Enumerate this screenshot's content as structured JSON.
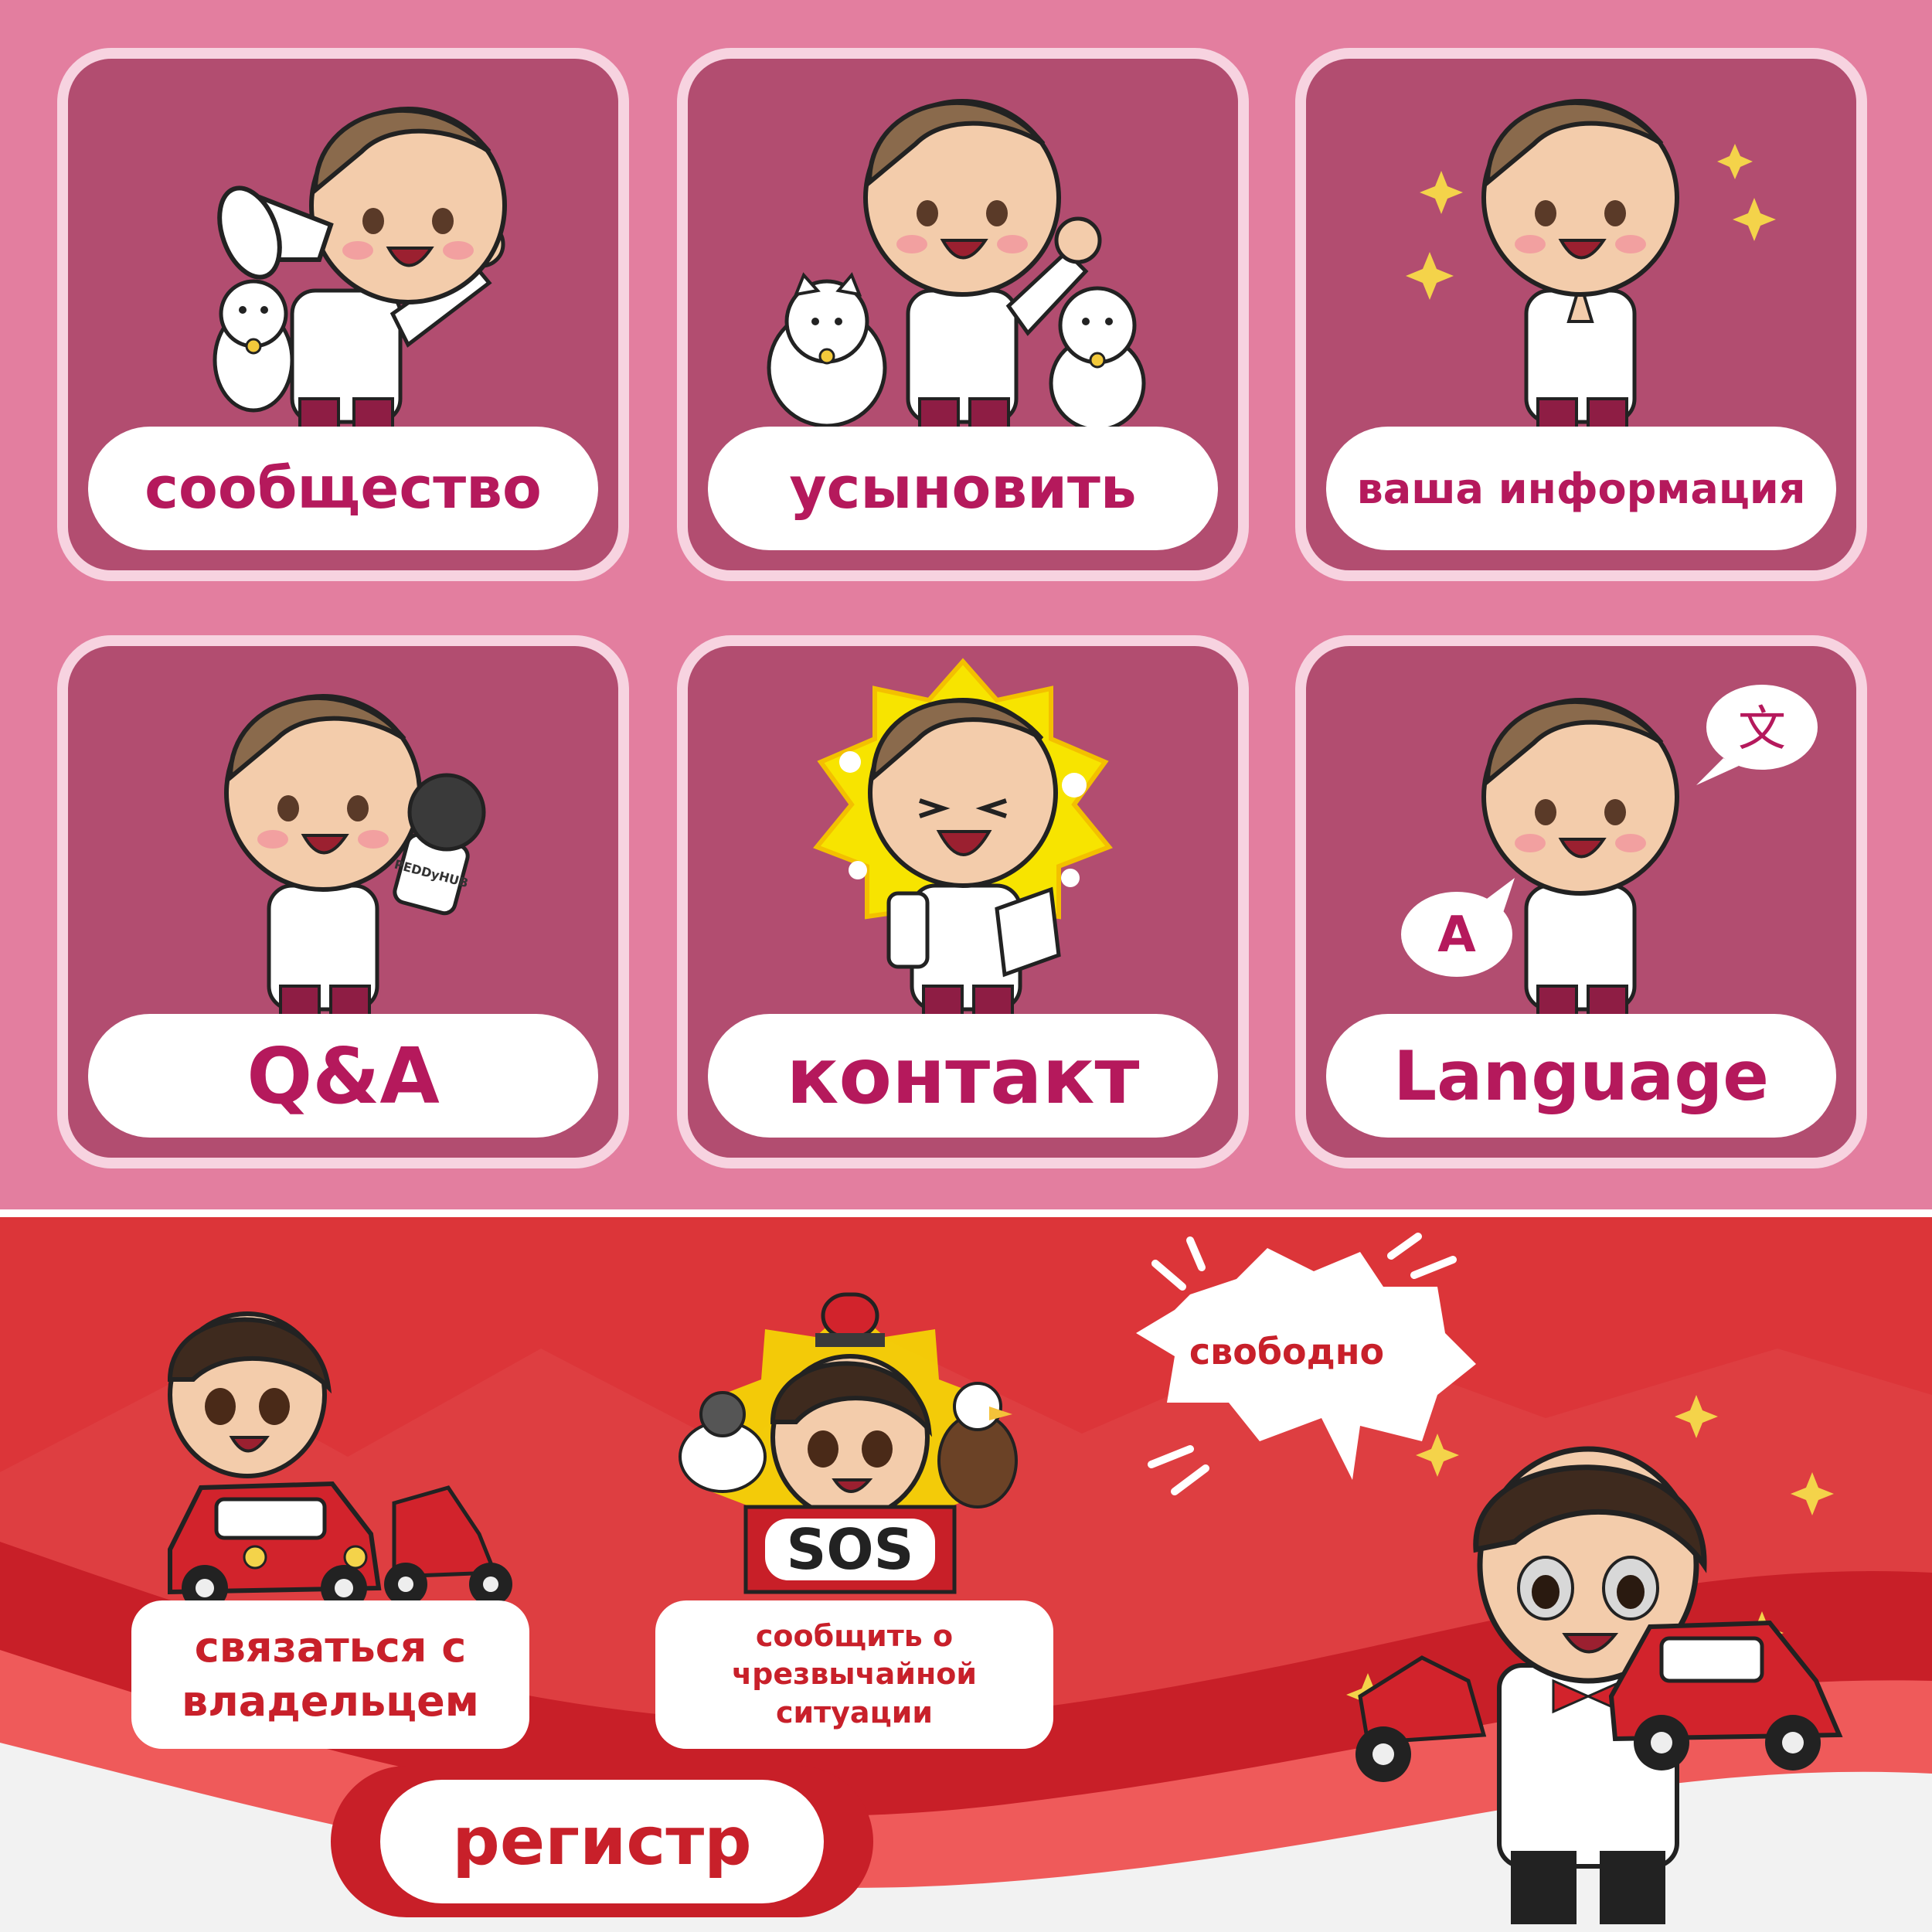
{
  "menu": {
    "cards": [
      {
        "label": "сообщество"
      },
      {
        "label": "усыновить"
      },
      {
        "label": "ваша информация"
      },
      {
        "label": "Q&A"
      },
      {
        "label": "контакт"
      },
      {
        "label": "Language"
      }
    ],
    "language_bubbles": {
      "left": "A",
      "right": "文"
    },
    "microphone_text": "PEDDyHUB"
  },
  "bottom": {
    "speech_bubble": "свободно",
    "contact_owner": {
      "line1": "связаться с",
      "line2": "владельцем"
    },
    "emergency": {
      "line1": "сообщить о",
      "line2": "чрезвычайной",
      "line3": "ситуации"
    },
    "sos_sign": "SOS",
    "register_label": "регистр"
  },
  "colors": {
    "pink_bg": "#e37e9f",
    "card_bg": "#b24d70",
    "card_border": "#f7d3e0",
    "pink_text": "#b5195c",
    "red_bg": "#dc3539",
    "red_text": "#c8202a",
    "white": "#ffffff"
  },
  "icons": [
    "megaphone-icon",
    "dog-icon",
    "cat-icon",
    "sparkle-icon",
    "microphone-icon",
    "star-burst-icon",
    "letter-icon",
    "phone-icon",
    "speech-bubble-icon",
    "car-icon",
    "scooter-icon",
    "siren-icon",
    "pigeon-icon",
    "eagle-icon"
  ]
}
